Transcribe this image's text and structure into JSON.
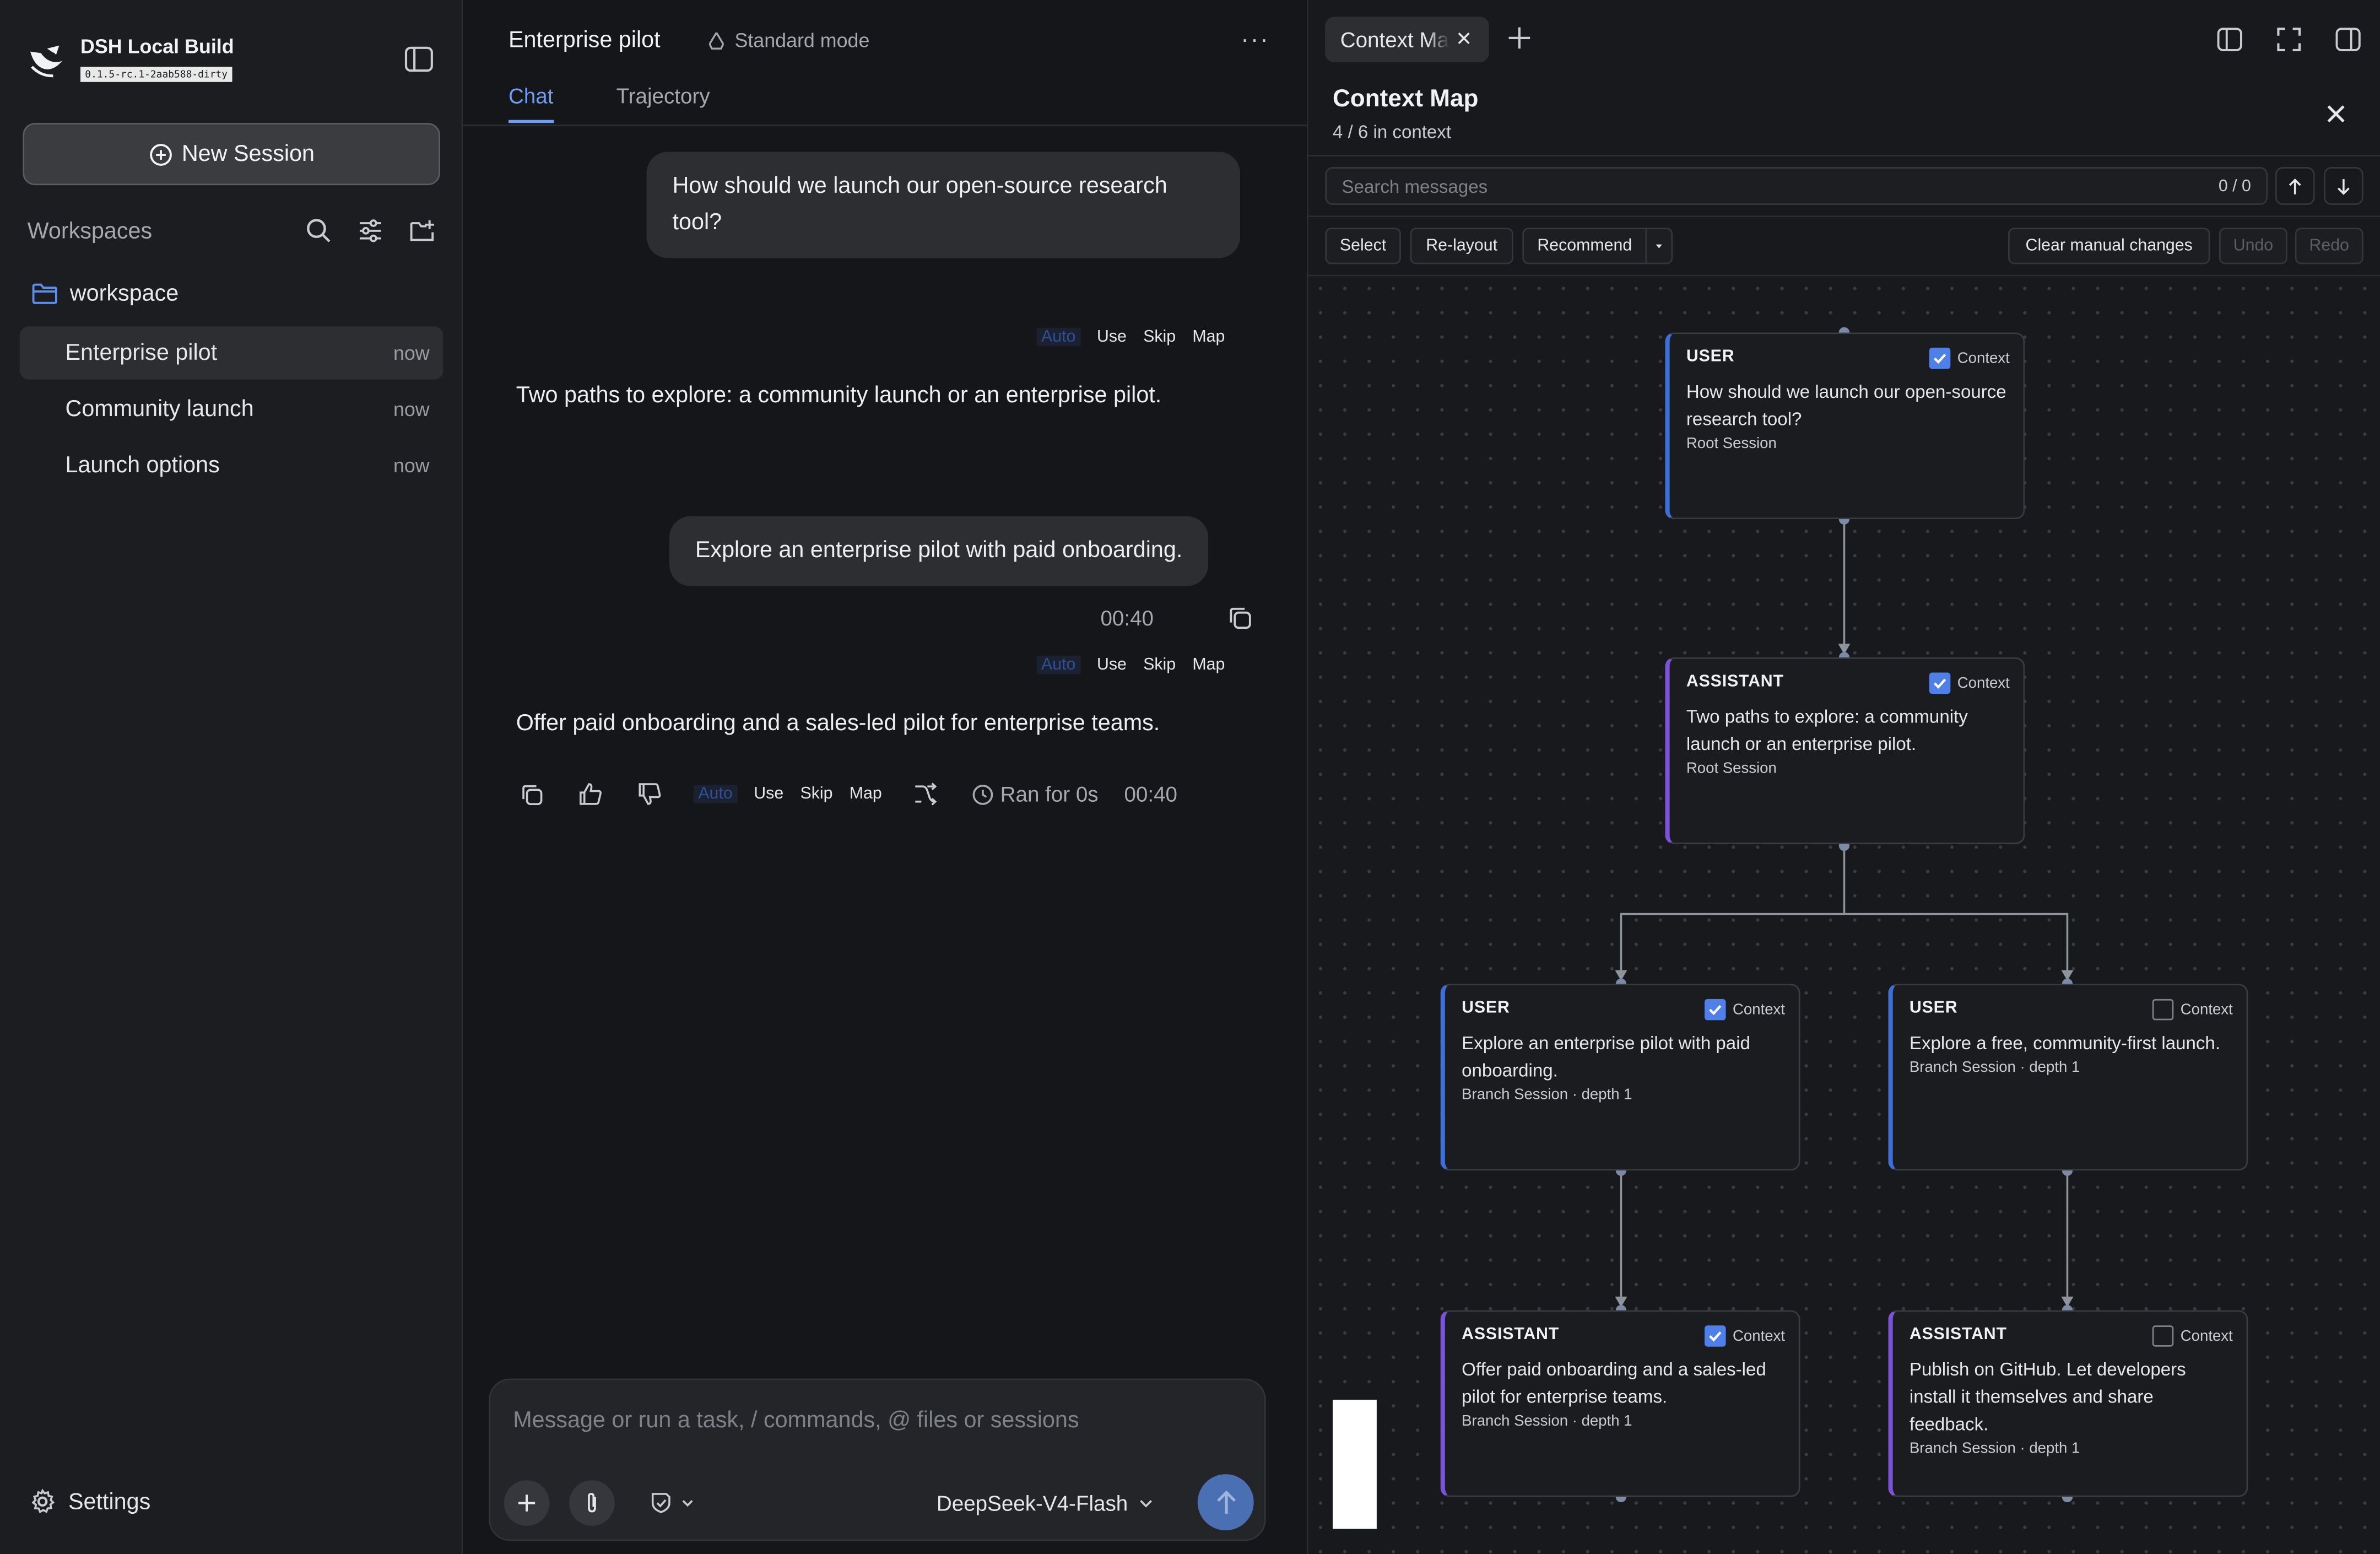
{
  "app": {
    "name": "DSH Local Build",
    "version": "0.1.5-rc.1-2aab588-dirty"
  },
  "sidebar": {
    "new_session_label": "New Session",
    "workspaces_label": "Workspaces",
    "folder_label": "workspace",
    "sessions": [
      {
        "label": "Enterprise pilot",
        "time": "now",
        "active": true
      },
      {
        "label": "Community launch",
        "time": "now",
        "active": false
      },
      {
        "label": "Launch options",
        "time": "now",
        "active": false
      }
    ],
    "settings_label": "Settings"
  },
  "chat": {
    "title": "Enterprise pilot",
    "mode": "Standard mode",
    "tabs": [
      {
        "label": "Chat",
        "active": true
      },
      {
        "label": "Trajectory",
        "active": false
      }
    ],
    "msg_user_1": "How should we launch our open-source research tool?",
    "msg_assistant_1": "Two paths to explore: a community launch or an enterprise pilot.",
    "msg_user_2": "Explore an enterprise pilot with paid onboarding.",
    "msg_user_2_time": "00:40",
    "msg_assistant_2": "Offer paid onboarding and a sales-led pilot for enterprise teams.",
    "ctl": {
      "auto": "Auto",
      "use": "Use",
      "skip": "Skip",
      "map": "Map"
    },
    "ran_for": "Ran for 0s",
    "ran_time": "00:40",
    "composer_placeholder": "Message or run a task, / commands, @ files or sessions",
    "model": "DeepSeek-V4-Flash"
  },
  "context_map": {
    "tab_label": "Context Map",
    "title": "Context Map",
    "subtitle": "4 / 6 in context",
    "search_placeholder": "Search messages",
    "search_count": "0 / 0",
    "toolbar": {
      "select": "Select",
      "relayout": "Re-layout",
      "recommend": "Recommend",
      "clear": "Clear manual changes",
      "undo": "Undo",
      "redo": "Redo"
    },
    "context_label": "Context",
    "nodes": [
      {
        "role": "USER",
        "text": "How should we launch our open-source research tool?",
        "meta": "Root Session",
        "in_context": true,
        "kind": "user"
      },
      {
        "role": "ASSISTANT",
        "text": "Two paths to explore: a community launch or an enterprise pilot.",
        "meta": "Root Session",
        "in_context": true,
        "kind": "assistant"
      },
      {
        "role": "USER",
        "text": "Explore an enterprise pilot with paid onboarding.",
        "meta": "Branch Session · depth 1",
        "in_context": true,
        "kind": "user"
      },
      {
        "role": "USER",
        "text": "Explore a free, community-first launch.",
        "meta": "Branch Session · depth 1",
        "in_context": false,
        "kind": "user"
      },
      {
        "role": "ASSISTANT",
        "text": "Offer paid onboarding and a sales-led pilot for enterprise teams.",
        "meta": "Branch Session · depth 1",
        "in_context": true,
        "kind": "assistant"
      },
      {
        "role": "ASSISTANT",
        "text": "Publish on GitHub. Let developers install it themselves and share feedback.",
        "meta": "Branch Session · depth 1",
        "in_context": false,
        "kind": "assistant"
      }
    ]
  },
  "colors": {
    "accent_blue": "#6f9ef5",
    "user_border": "#3e6fd6",
    "assistant_border": "#7b52d8",
    "checkbox_on": "#4f7fe8",
    "send_button": "#4a6fb3"
  }
}
